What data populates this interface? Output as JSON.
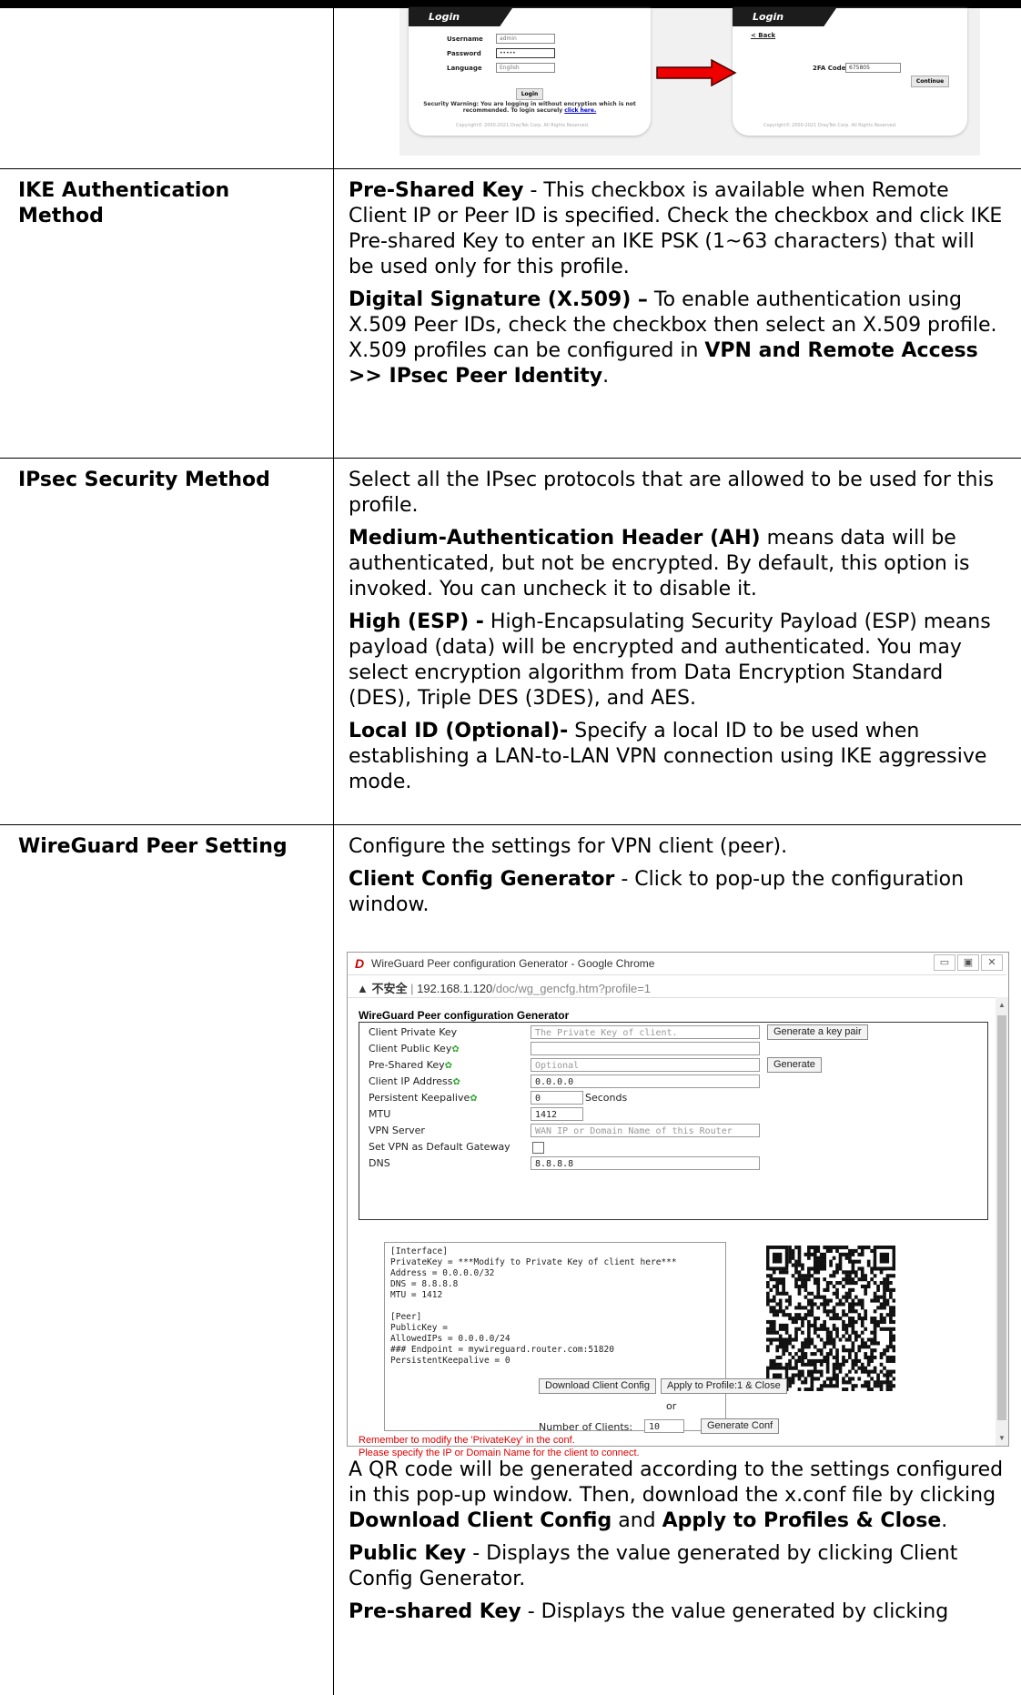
{
  "rows": {
    "ike": {
      "label": "IKE Authentication Method",
      "psk_term": "Pre-Shared Key",
      "psk_text": " - This checkbox is available when Remote Client IP or Peer ID is specified. Check the checkbox and click IKE Pre-shared Key to enter an IKE PSK (1~63 characters) that will be used only for this profile.",
      "ds_term": "Digital Signature (X.509) –",
      "ds_text": " To enable authentication using X.509 Peer IDs, check the checkbox then select an X.509 profile. X.509 profiles can be configured ",
      "ds_in": "in ",
      "ds_path": "VPN and Remote Access >> IPsec Peer Identity",
      "ds_end": "."
    },
    "ipsec": {
      "label": "IPsec Security Method",
      "intro": "Select all the IPsec protocols that are allowed to be used for this profile.",
      "ah_term": "Medium-Authentication Header (AH)",
      "ah_text": " means data will be authenticated, but not be encrypted. By default, this option is invoked. You can uncheck it to disable it.",
      "esp_term": "High (ESP) -",
      "esp_text": " High-Encapsulating Security Payload (ESP) means payload (data) will be encrypted and authenticated. You may select encryption algorithm from Data Encryption Standard (DES), Triple DES (3DES), and AES.",
      "lid_term": "Local ID (Optional)-",
      "lid_text": " Specify a local ID to be used when establishing a LAN-to-LAN VPN connection using IKE aggressive mode."
    },
    "wg": {
      "label": "WireGuard Peer Setting",
      "intro": "Configure the settings for VPN client (peer).",
      "ccg_term": "Client Config Generator",
      "ccg_text": " - Click to pop-up the configuration window.",
      "qr_text_1": "A QR code will be generated according to the settings configured in this pop-up window. Then, download the x.conf file by clicking ",
      "qr_b1": "Download Client Config",
      "qr_and": " and ",
      "qr_b2": "Apply to Profiles & Close",
      "qr_end": ".",
      "pub_term": "Public Key",
      "pub_text": " - Displays the value generated by clicking Client Config Generator.",
      "psk_term": "Pre-shared Key",
      "psk_text": " - Displays the value generated by clicking"
    }
  },
  "login_shot": {
    "left_title": "Login",
    "username_label": "Username",
    "username_value": "admin",
    "password_label": "Password",
    "password_value": "•••••",
    "language_label": "Language",
    "language_value": "English",
    "login_button": "Login",
    "warning_prefix": "Security Warning: You are logging in without encryption which is not recommended. To login securely ",
    "warning_link": "click here.",
    "copyright": "Copyright© 2000-2021 DrayTek Corp. All Rights Reserved.",
    "right_title": "Login",
    "back_link": "< Back",
    "twofa_label": "2FA Code",
    "twofa_value": "675805",
    "continue_button": "Continue"
  },
  "wg_window": {
    "title": "WireGuard Peer configuration Generator - Google Chrome",
    "address_warn": "▲ 不安全",
    "address_sep": " | ",
    "address_host": "192.168.1.120",
    "address_path": "/doc/wg_gencfg.htm?profile=1",
    "heading": "WireGuard Peer configuration Generator",
    "fields": {
      "private_key_label": "Client Private Key",
      "private_key_placeholder": "The Private Key of client.",
      "gen_pair_button": "Generate a key pair",
      "public_key_label": "Client Public Key",
      "psk_label": "Pre-Shared Key",
      "psk_placeholder": "Optional",
      "generate_button": "Generate",
      "client_ip_label": "Client IP Address",
      "client_ip_value": "0.0.0.0",
      "keepalive_label": "Persistent Keepalive",
      "keepalive_value": "0",
      "keepalive_unit": "Seconds",
      "mtu_label": "MTU",
      "mtu_value": "1412",
      "vpn_server_label": "VPN Server",
      "vpn_server_placeholder": "WAN IP or Domain Name of this Router",
      "default_gw_label": "Set VPN as Default Gateway",
      "dns_label": "DNS",
      "dns_value": "8.8.8.8"
    },
    "config_text": "[Interface]\nPrivateKey = ***Modify to Private Key of client here***\nAddress = 0.0.0.0/32\nDNS = 8.8.8.8\nMTU = 1412\n\n[Peer]\nPublicKey =\nAllowedIPs = 0.0.0.0/24\n### Endpoint = mywireguard.router.com:51820\nPersistentKeepalive = 0",
    "warn1": "Remember to modify the 'PrivateKey' in the conf.",
    "warn2": "Please specify the IP or Domain Name for the client to connect.",
    "download_button": "Download Client Config",
    "apply_button": "Apply to Profile:1 & Close",
    "or_text": "or",
    "num_clients_label": "Number of Clients:",
    "num_clients_value": "10",
    "generate_conf_button": "Generate Conf"
  }
}
